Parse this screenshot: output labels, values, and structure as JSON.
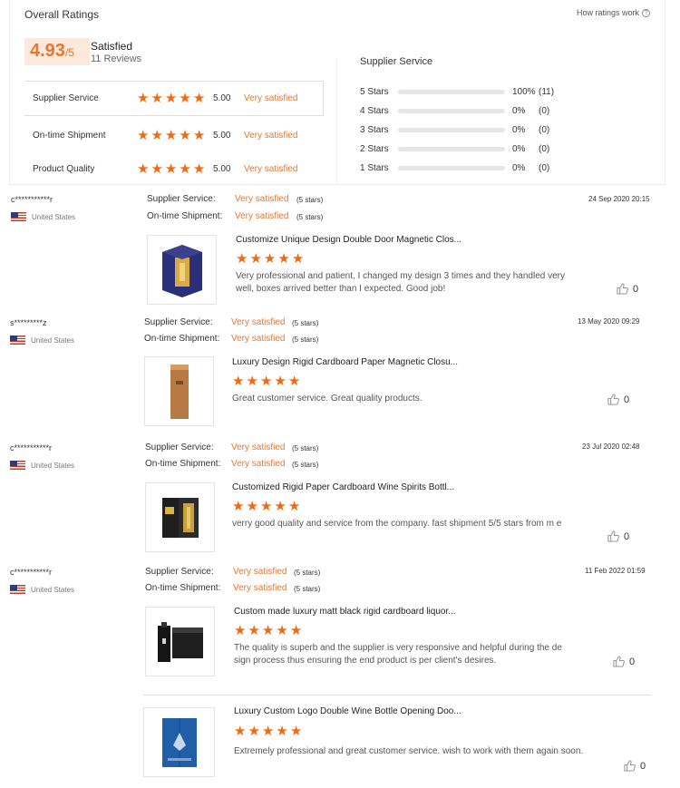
{
  "summary": {
    "title": "Overall Ratings",
    "how_link": "How ratings work",
    "how_icon": "question-icon",
    "score": "4.93",
    "score_den": "/5",
    "satisfied": "Satisfied",
    "reviews": "11 Reviews",
    "accent": "#ee6a14",
    "ratings": [
      {
        "label": "Supplier Service",
        "value": "5.00",
        "sat": "Very satisfied",
        "stars": 5
      },
      {
        "label": "On-time Shipment",
        "value": "5.00",
        "sat": "Very satisfied",
        "stars": 5
      },
      {
        "label": "Product Quality",
        "value": "5.00",
        "sat": "Very satisfied",
        "stars": 5
      }
    ],
    "supplier_title": "Supplier Service",
    "breakdown": [
      {
        "label": "5 Stars",
        "pct": "100%",
        "count": "(11)",
        "fill": 1.0
      },
      {
        "label": "4 Stars",
        "pct": "0%",
        "count": "(0)",
        "fill": 0
      },
      {
        "label": "3 Stars",
        "pct": "0%",
        "count": "(0)",
        "fill": 0
      },
      {
        "label": "2 Stars",
        "pct": "0%",
        "count": "(0)",
        "fill": 0
      },
      {
        "label": "1 Stars",
        "pct": "0%",
        "count": "(0)",
        "fill": 0
      }
    ]
  },
  "reviews": [
    {
      "user": "c***********r",
      "country": "United States",
      "date": "24 Sep 2020 20:15",
      "f1_label": "Supplier Service:",
      "f1_value": "Very satisfied",
      "f1_stars": "(5 stars)",
      "f2_label": "On-time Shipment:",
      "f2_value": "Very satisfied",
      "f2_stars": "(5 stars)",
      "product": "Customize Unique Design Double Door Magnetic Clos...",
      "rating": 5,
      "text": "Very professional and patient, I changed my design 3 times and they handled very well, boxes arrived better than I expected. Good job!",
      "likes": "0",
      "image": "blue-gold-box"
    },
    {
      "user": "s*********z",
      "country": "United States",
      "date": "13 May 2020 09:29",
      "f1_label": "Supplier Service:",
      "f1_value": "Very satisfied",
      "f1_stars": "(5 stars)",
      "f2_label": "On-time Shipment:",
      "f2_value": "Very satisfied",
      "f2_stars": "(5 stars)",
      "product": "Luxury Design Rigid Cardboard Paper Magnetic Closu...",
      "rating": 5,
      "text": "Great customer service. Great quality products.",
      "likes": "0",
      "image": "brown-bottle-box"
    },
    {
      "user": "c***********r",
      "country": "United States",
      "date": "23 Jul 2020 02:48",
      "f1_label": "Supplier Service:",
      "f1_value": "Very satisfied",
      "f1_stars": "(5 stars)",
      "f2_label": "On-time Shipment:",
      "f2_value": "Very satisfied",
      "f2_stars": "(5 stars)",
      "product": "Customized Rigid Paper Cardboard Wine Spirits Bottl...",
      "rating": 5,
      "text": "verry good quality and service from the company. fast shipment 5/5 stars from m e",
      "likes": "0",
      "image": "black-open-box"
    },
    {
      "user": "c***********r",
      "country": "United States",
      "date": "11 Feb 2022 01:59",
      "f1_label": "Supplier Service:",
      "f1_value": "Very satisfied",
      "f1_stars": "(5 stars)",
      "f2_label": "On-time Shipment:",
      "f2_value": "Very satisfied",
      "f2_stars": "(5 stars)",
      "product": "Custom made luxury matt black rigid cardboard liquor...",
      "rating": 5,
      "text": "The quality is superb and the supplier is very responsive and helpful during the de sign process thus ensuring the end product is per client's desires.",
      "likes": "0",
      "image": "matt-black-box"
    },
    {
      "product": "Luxury Custom Logo Double Wine Bottle Opening Doo...",
      "rating": 5,
      "text": "Extremely professional and great customer service. wish to work with them again soon.",
      "likes": "0",
      "image": "blue-double-box"
    }
  ]
}
